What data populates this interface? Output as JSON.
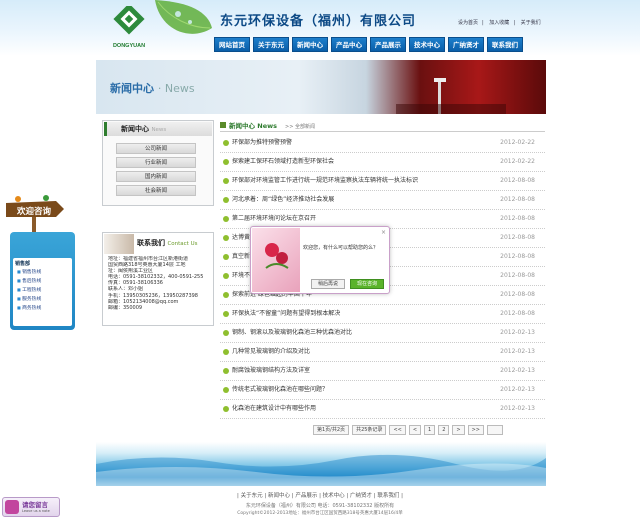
{
  "header": {
    "logo_text": "DONGYUAN",
    "site_title": "东元环保设备（福州）有限公司",
    "top_links": [
      "设为首页",
      "加入收藏",
      "关于我们"
    ],
    "nav": [
      "网站首页",
      "关于东元",
      "新闻中心",
      "产品中心",
      "产品展示",
      "技术中心",
      "广纳贤才",
      "联系我们"
    ]
  },
  "banner": {
    "title": "新闻中心",
    "subtitle": "· News"
  },
  "sidebar": {
    "news_title": "新闻中心",
    "news_title_en": "News",
    "categories": [
      "公司新闻",
      "行业新闻",
      "国内新闻",
      "社会新闻"
    ],
    "contact_title": "联系我们",
    "contact_title_en": "Contact Us",
    "contact_lines": [
      "地址：福建省福州市台江区新港街道",
      "国贸西路318号英惠大厦14层  工地",
      "址：闽侯荆溪工业区",
      "电话：0591-38102332，400-0591-255",
      "传真：0591-38106336",
      "联系人：邓小姐",
      "手机：13950305236，13950287398",
      "邮箱：1052134008@qq.com",
      "邮编：350009"
    ]
  },
  "consult": {
    "label": "欢迎咨询",
    "panel_title": "销售部",
    "items": [
      "销售热线",
      "售后热线",
      "工程热线",
      "服务热线",
      "商务热线"
    ]
  },
  "message": {
    "label": "请您留言",
    "sub": "Leave us a note"
  },
  "list": {
    "head_title": "新闻中心 News",
    "breadcrumb": ">> 全部新闻",
    "rows": [
      {
        "title": "环保部为推特预警预警",
        "date": "2012-02-22"
      },
      {
        "title": "探索建工保环石领域打造新型环保社会",
        "date": "2012-02-22"
      },
      {
        "title": "环保部对环境监管工作进行统一规范环境监察执法车辆将统一执法标识",
        "date": "2012-08-08"
      },
      {
        "title": "河北承着：周“绿色”经济推动社会发展",
        "date": "2012-08-08"
      },
      {
        "title": "第二届环境环境问论坛在京召开",
        "date": "2012-08-08"
      },
      {
        "title": "达博黄标",
        "date": "2012-08-08"
      },
      {
        "title": "真空新",
        "date": "2012-08-08"
      },
      {
        "title": "环境不",
        "date": "2012-08-08"
      },
      {
        "title": "探索前进 绿色崛起的中国十年",
        "date": "2012-08-08"
      },
      {
        "title": "环保执法“不留童”问题有望得到根本解决",
        "date": "2012-08-08"
      },
      {
        "title": "钢制、钢滚以及玻璃钢化森池三种优森池对比",
        "date": "2012-02-13"
      },
      {
        "title": "几种常见玻璃钢的介绍及对比",
        "date": "2012-02-13"
      },
      {
        "title": "耐腐蚀玻璃钢结构方法及详室",
        "date": "2012-02-13"
      },
      {
        "title": "传统老式玻璃钢化森池在哪些问题？",
        "date": "2012-02-13"
      },
      {
        "title": "化森池在建筑设计中有哪些作用",
        "date": "2012-02-13"
      }
    ],
    "pager": {
      "info": "第1页/共2页",
      "total": "共25条记录",
      "pages": [
        "<<",
        "<",
        "1",
        "2",
        ">",
        ">>"
      ]
    }
  },
  "popup": {
    "text": "欢迎您，有什么可以帮助您的么？",
    "later": "稍后再说",
    "now": "现在咨询",
    "close": "×"
  },
  "footer": {
    "nav": "| 关于东元 | 新闻中心 | 产品展示 | 技术中心 | 广纳贤才 | 联系我们 |",
    "line1": "东元环保设备（福州）有限公司  电话：0591-38102332  版权所有",
    "line2": "Copyright©2012-2013地址：福州市台江区国贸西路318号英惠大厦14层16/4单"
  }
}
